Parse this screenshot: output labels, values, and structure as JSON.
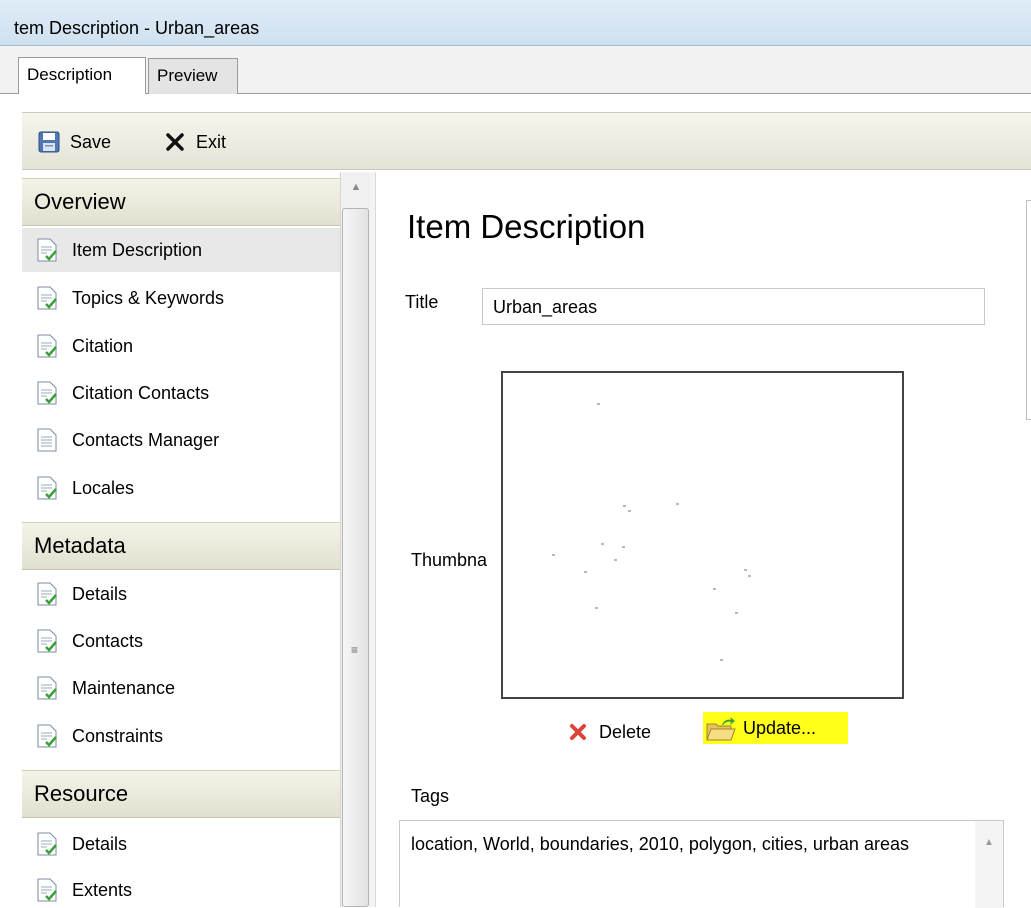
{
  "window": {
    "title": "tem Description - Urban_areas"
  },
  "tabs": [
    {
      "label": "Description",
      "active": true
    },
    {
      "label": "Preview",
      "active": false
    }
  ],
  "toolbar": {
    "save_label": "Save",
    "exit_label": "Exit"
  },
  "sidebar": {
    "sections": [
      {
        "title": "Overview",
        "items": [
          {
            "label": "Item Description",
            "selected": true,
            "icon": "document-check-icon"
          },
          {
            "label": "Topics & Keywords",
            "icon": "document-check-icon"
          },
          {
            "label": "Citation",
            "icon": "document-check-icon"
          },
          {
            "label": "Citation Contacts",
            "icon": "document-check-icon"
          },
          {
            "label": "Contacts Manager",
            "icon": "document-icon"
          },
          {
            "label": "Locales",
            "icon": "document-check-icon"
          }
        ]
      },
      {
        "title": "Metadata",
        "items": [
          {
            "label": "Details",
            "icon": "document-check-icon"
          },
          {
            "label": "Contacts",
            "icon": "document-check-icon"
          },
          {
            "label": "Maintenance",
            "icon": "document-check-icon"
          },
          {
            "label": "Constraints",
            "icon": "document-check-icon"
          }
        ]
      },
      {
        "title": "Resource",
        "items": [
          {
            "label": "Details",
            "icon": "document-check-icon"
          },
          {
            "label": "Extents",
            "icon": "document-check-icon"
          }
        ]
      }
    ]
  },
  "main": {
    "heading": "Item Description",
    "title_label": "Title",
    "title_value": "Urban_areas",
    "thumbnail_label": "Thumbna",
    "delete_label": "Delete",
    "update_label": "Update...",
    "tags_label": "Tags",
    "tags_value": "location, World, boundaries, 2010, polygon, cities, urban areas"
  },
  "colors": {
    "highlight": "#ffff1a",
    "delete_x": "#d9453b",
    "check_green": "#3aa03a"
  }
}
